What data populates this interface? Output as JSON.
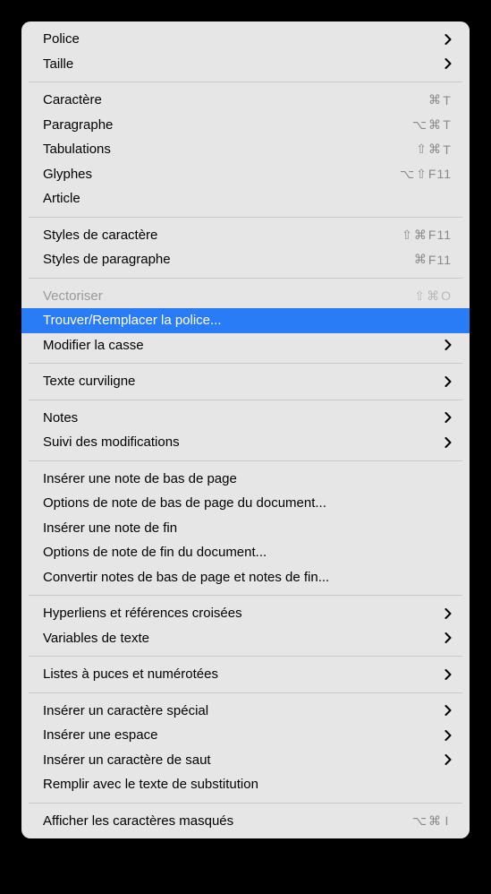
{
  "menu": {
    "sections": [
      [
        {
          "id": "police",
          "label": "Police",
          "submenu": true
        },
        {
          "id": "taille",
          "label": "Taille",
          "submenu": true
        }
      ],
      [
        {
          "id": "caractere",
          "label": "Caractère",
          "shortcut": "⌘ T"
        },
        {
          "id": "paragraphe",
          "label": "Paragraphe",
          "shortcut": "⌥ ⌘ T"
        },
        {
          "id": "tabulations",
          "label": "Tabulations",
          "shortcut": "⇧ ⌘ T"
        },
        {
          "id": "glyphes",
          "label": "Glyphes",
          "shortcut": "⌥ ⇧ F11"
        },
        {
          "id": "article",
          "label": "Article"
        }
      ],
      [
        {
          "id": "styles-caractere",
          "label": "Styles de caractère",
          "shortcut": "⇧ ⌘ F11"
        },
        {
          "id": "styles-paragraphe",
          "label": "Styles de paragraphe",
          "shortcut": "⌘ F11"
        }
      ],
      [
        {
          "id": "vectoriser",
          "label": "Vectoriser",
          "shortcut": "⇧ ⌘ O",
          "disabled": true
        },
        {
          "id": "trouver-police",
          "label": "Trouver/Remplacer la police...",
          "highlighted": true
        },
        {
          "id": "modifier-casse",
          "label": "Modifier la casse",
          "submenu": true
        }
      ],
      [
        {
          "id": "texte-curviligne",
          "label": "Texte curviligne",
          "submenu": true
        }
      ],
      [
        {
          "id": "notes",
          "label": "Notes",
          "submenu": true
        },
        {
          "id": "suivi-modifications",
          "label": "Suivi des modifications",
          "submenu": true
        }
      ],
      [
        {
          "id": "inserer-note-bas",
          "label": "Insérer une note de bas de page"
        },
        {
          "id": "options-note-bas",
          "label": "Options de note de bas de page du document..."
        },
        {
          "id": "inserer-note-fin",
          "label": "Insérer une note de fin"
        },
        {
          "id": "options-note-fin",
          "label": "Options de note de fin du document..."
        },
        {
          "id": "convertir-notes",
          "label": "Convertir notes de bas de page et notes de fin..."
        }
      ],
      [
        {
          "id": "hyperliens",
          "label": "Hyperliens et références croisées",
          "submenu": true
        },
        {
          "id": "variables-texte",
          "label": "Variables de texte",
          "submenu": true
        }
      ],
      [
        {
          "id": "listes-puces",
          "label": "Listes à puces et numérotées",
          "submenu": true
        }
      ],
      [
        {
          "id": "inserer-caractere-special",
          "label": "Insérer un caractère spécial",
          "submenu": true
        },
        {
          "id": "inserer-espace",
          "label": "Insérer une espace",
          "submenu": true
        },
        {
          "id": "inserer-saut",
          "label": "Insérer un caractère de saut",
          "submenu": true
        },
        {
          "id": "remplir-substitution",
          "label": "Remplir avec le texte de substitution"
        }
      ],
      [
        {
          "id": "afficher-masques",
          "label": "Afficher les caractères masqués",
          "shortcut": "⌥ ⌘ I"
        }
      ]
    ]
  }
}
